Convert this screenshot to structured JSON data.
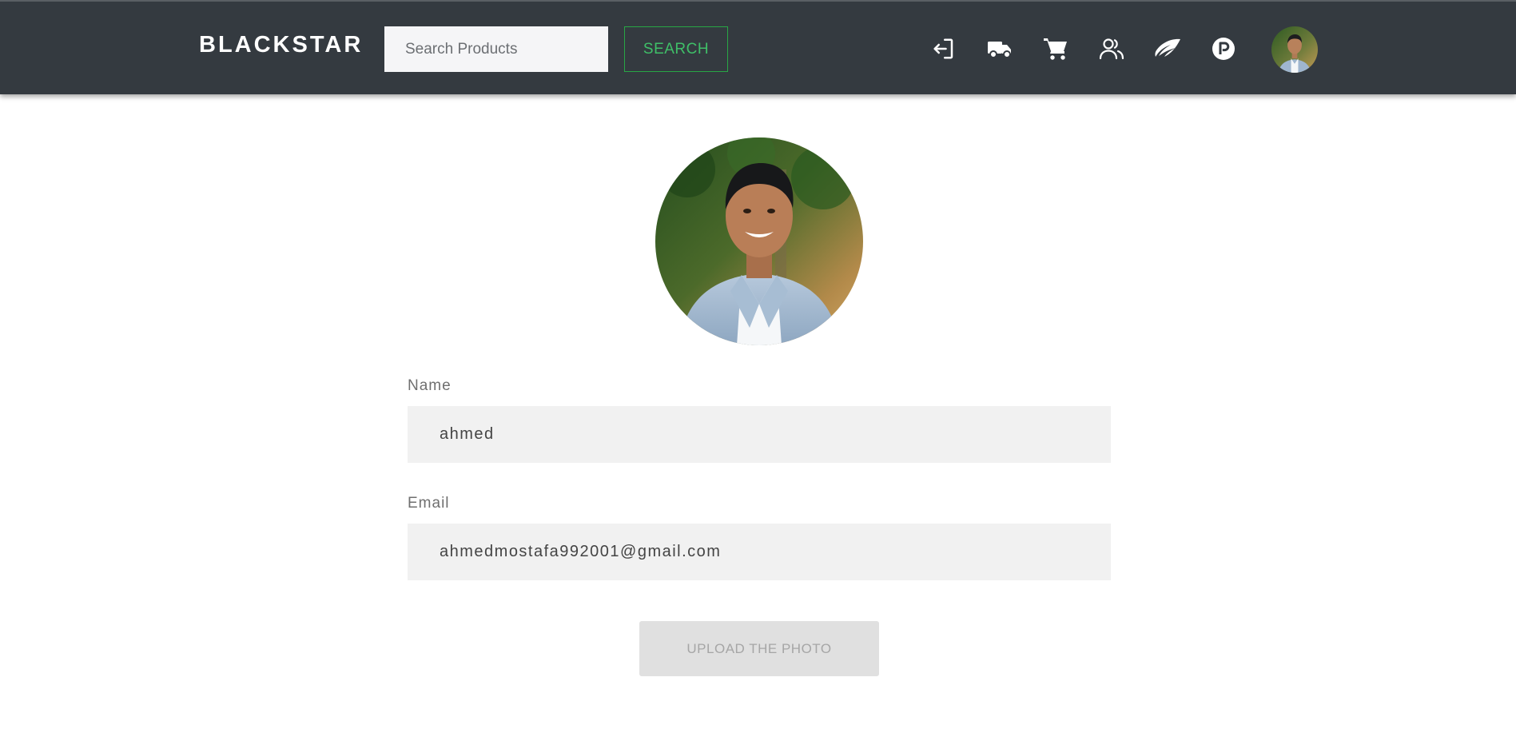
{
  "navbar": {
    "brand": "BLACKSTAR",
    "search_placeholder": "Search Products",
    "search_button": "SEARCH",
    "icons": [
      "login-icon",
      "truck-icon",
      "cart-icon",
      "users-icon",
      "wing-icon",
      "parking-icon",
      "user-avatar"
    ]
  },
  "profile": {
    "name_label": "Name",
    "name_value": "ahmed",
    "email_label": "Email",
    "email_value": "ahmedmostafa992001@gmail.com",
    "upload_button": "UPLOAD THE PHOTO"
  },
  "colors": {
    "navbar_bg": "#343a40",
    "search_button_accent": "#28a745",
    "field_bg": "#f1f1f1",
    "upload_button_bg": "#e0e0e0"
  }
}
